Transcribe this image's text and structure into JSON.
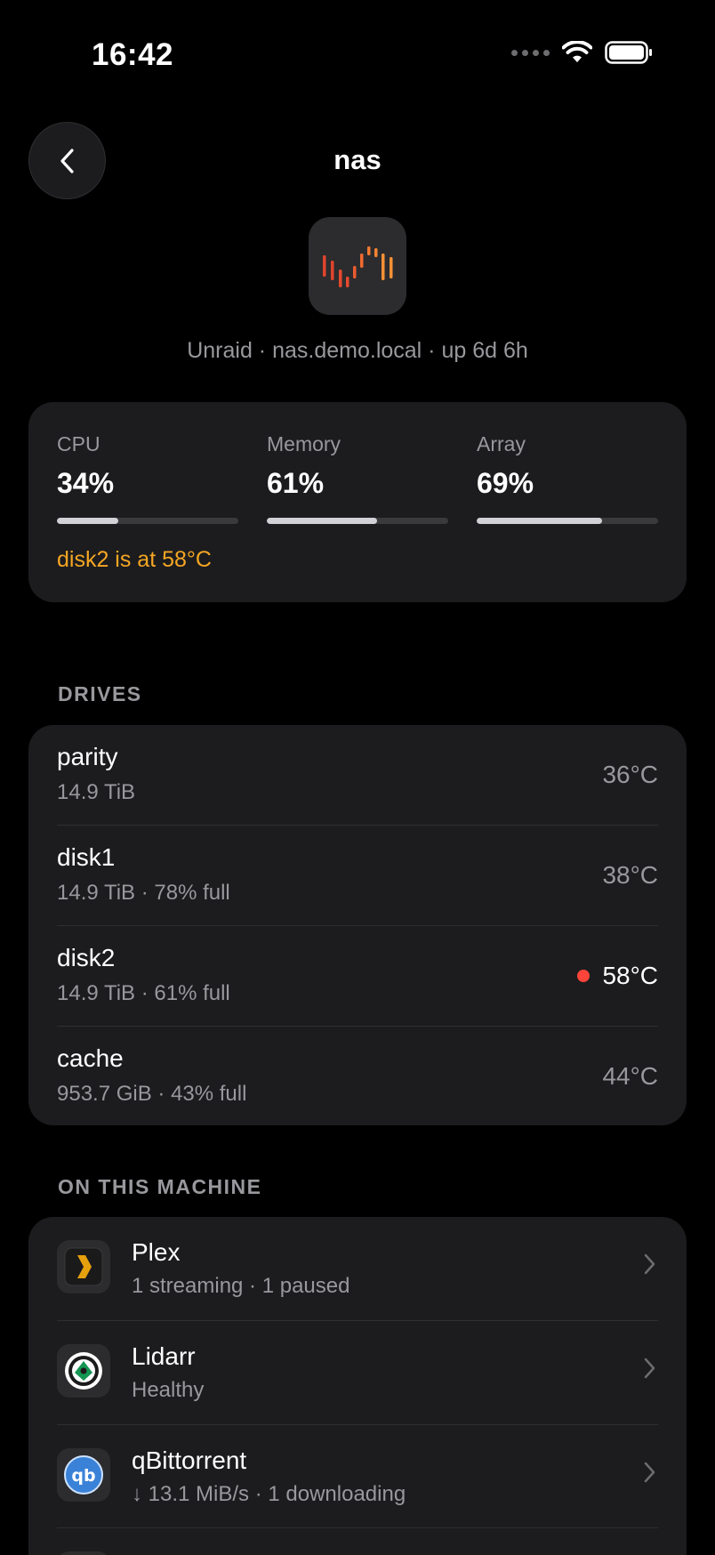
{
  "status_bar": {
    "time": "16:42"
  },
  "header": {
    "title": "nas",
    "subtitle": "Unraid · nas.demo.local · up 6d 6h"
  },
  "stats": [
    {
      "label": "CPU",
      "value": "34%",
      "fill": 0.34
    },
    {
      "label": "Memory",
      "value": "61%",
      "fill": 0.61
    },
    {
      "label": "Array",
      "value": "69%",
      "fill": 0.69
    }
  ],
  "warning": "disk2 is at 58°C",
  "drives_section": "DRIVES",
  "drives": [
    {
      "name": "parity",
      "meta": "14.9 TiB",
      "temp": "36°C"
    },
    {
      "name": "disk1",
      "meta": "14.9 TiB · 78% full",
      "temp": "38°C"
    },
    {
      "name": "disk2",
      "meta": "14.9 TiB · 61% full",
      "temp": "58°C"
    },
    {
      "name": "cache",
      "meta": "953.7 GiB · 43% full",
      "temp": "44°C"
    }
  ],
  "apps_section": "ON THIS MACHINE",
  "apps": [
    {
      "name": "Plex",
      "status": "1 streaming · 1 paused",
      "icon": "plex-icon"
    },
    {
      "name": "Lidarr",
      "status": "Healthy",
      "icon": "lidarr-icon"
    },
    {
      "name": "qBittorrent",
      "status": "↓ 13.1 MiB/s · 1 downloading",
      "icon": "qbittorrent-icon"
    }
  ],
  "colors": {
    "background": "#000000",
    "card": "#1c1c1e",
    "warning": "#f5a623",
    "alert": "#ff453a"
  }
}
